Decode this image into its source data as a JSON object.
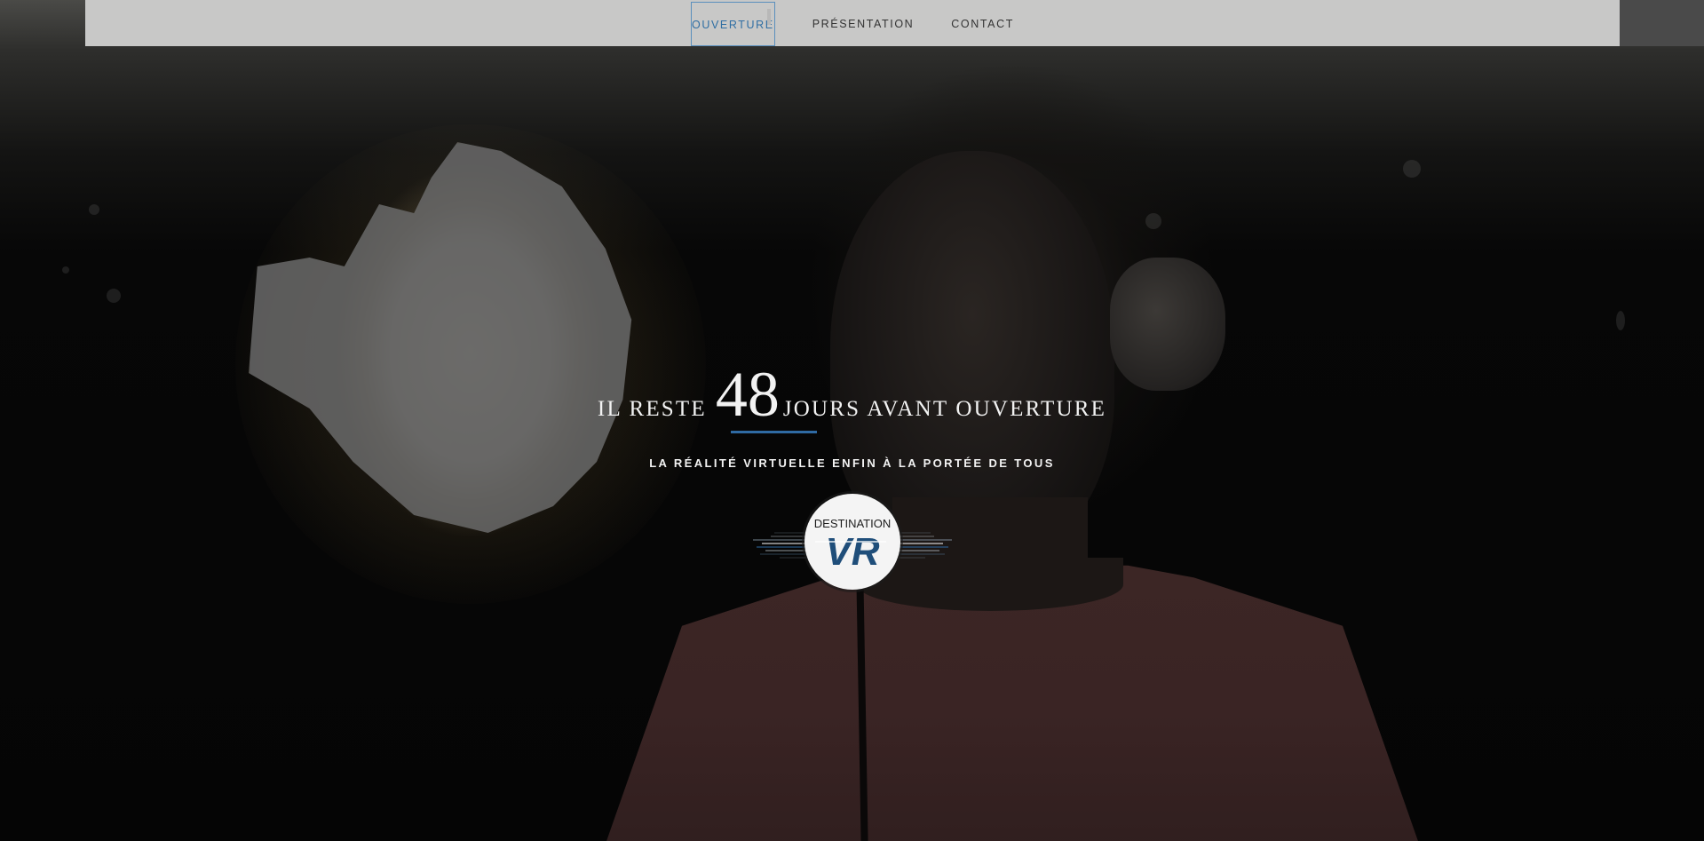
{
  "nav": {
    "items": [
      {
        "label": "OUVERTURE",
        "active": true
      },
      {
        "label": "PRÉSENTATION",
        "active": false
      },
      {
        "label": "CONTACT",
        "active": false
      }
    ]
  },
  "hero": {
    "title_prefix": "IL RESTE",
    "days_count": "48",
    "title_suffix": "JOURS AVANT OUVERTURE",
    "subtitle": "LA RÉALITÉ VIRTUELLE ENFIN À LA PORTÉE DE TOUS"
  },
  "logo": {
    "top_text": "DESTINATION",
    "main_text": "VR"
  },
  "colors": {
    "accent": "#2f6aa3",
    "nav_background": "#c8c8c7",
    "hero_background": "#050505"
  }
}
